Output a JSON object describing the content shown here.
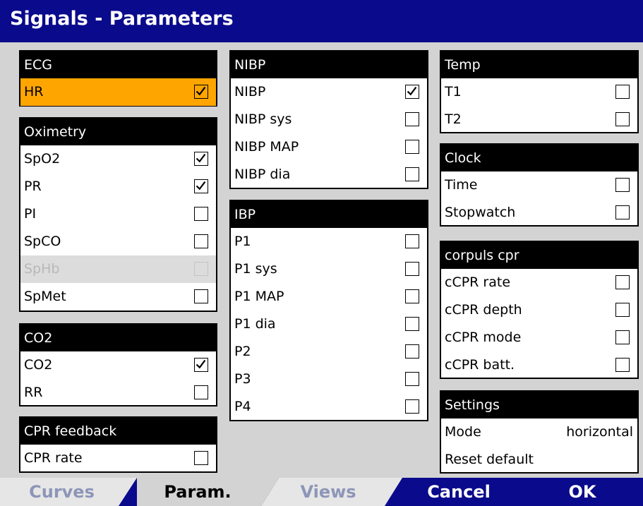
{
  "window": {
    "title": "Signals - Parameters"
  },
  "colors": {
    "title_bar": "#0a0a8c",
    "highlight": "#ffa500",
    "background": "#d3d3d3"
  },
  "groups": {
    "ecg": {
      "title": "ECG",
      "items": [
        {
          "label": "HR",
          "checked": true,
          "highlighted": true
        }
      ]
    },
    "oximetry": {
      "title": "Oximetry",
      "items": [
        {
          "label": "SpO2",
          "checked": true
        },
        {
          "label": "PR",
          "checked": true
        },
        {
          "label": "PI",
          "checked": false
        },
        {
          "label": "SpCO",
          "checked": false
        },
        {
          "label": "SpHb",
          "checked": false,
          "disabled": true
        },
        {
          "label": "SpMet",
          "checked": false
        }
      ]
    },
    "co2": {
      "title": "CO2",
      "items": [
        {
          "label": "CO2",
          "checked": true
        },
        {
          "label": "RR",
          "checked": false
        }
      ]
    },
    "cpr_feedback": {
      "title": "CPR feedback",
      "items": [
        {
          "label": "CPR rate",
          "checked": false
        }
      ]
    },
    "nibp": {
      "title": "NIBP",
      "items": [
        {
          "label": "NIBP",
          "checked": true
        },
        {
          "label": "NIBP sys",
          "checked": false
        },
        {
          "label": "NIBP MAP",
          "checked": false
        },
        {
          "label": "NIBP dia",
          "checked": false
        }
      ]
    },
    "ibp": {
      "title": "IBP",
      "items": [
        {
          "label": "P1",
          "checked": false
        },
        {
          "label": "P1 sys",
          "checked": false
        },
        {
          "label": "P1 MAP",
          "checked": false
        },
        {
          "label": "P1 dia",
          "checked": false
        },
        {
          "label": "P2",
          "checked": false
        },
        {
          "label": "P3",
          "checked": false
        },
        {
          "label": "P4",
          "checked": false
        }
      ]
    },
    "temp": {
      "title": "Temp",
      "items": [
        {
          "label": "T1",
          "checked": false
        },
        {
          "label": "T2",
          "checked": false
        }
      ]
    },
    "clock": {
      "title": "Clock",
      "items": [
        {
          "label": "Time",
          "checked": false
        },
        {
          "label": "Stopwatch",
          "checked": false
        }
      ]
    },
    "corpuls_cpr": {
      "title": "corpuls cpr",
      "items": [
        {
          "label": "cCPR rate",
          "checked": false
        },
        {
          "label": "cCPR depth",
          "checked": false
        },
        {
          "label": "cCPR mode",
          "checked": false
        },
        {
          "label": "cCPR batt.",
          "checked": false
        }
      ]
    },
    "settings": {
      "title": "Settings",
      "mode_label": "Mode",
      "mode_value": "horizontal",
      "reset_label": "Reset default"
    }
  },
  "tabs": {
    "curves": "Curves",
    "param": "Param.",
    "views": "Views",
    "cancel": "Cancel",
    "ok": "OK"
  }
}
